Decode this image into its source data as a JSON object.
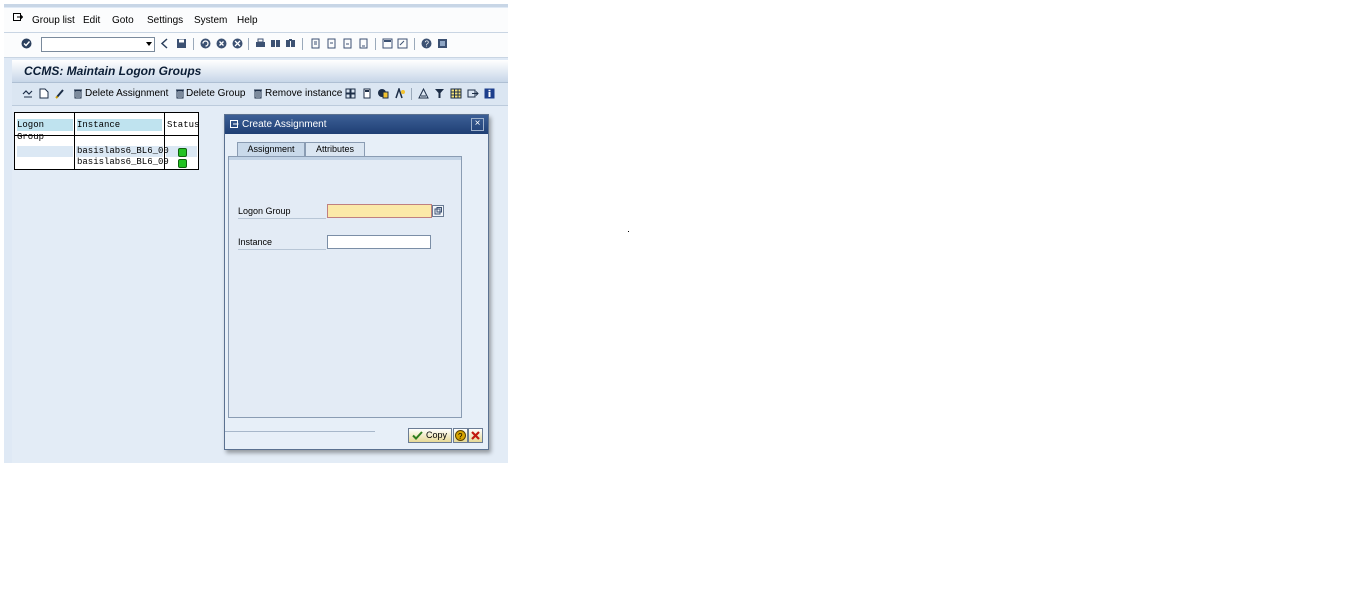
{
  "menu": {
    "items": [
      "Group list",
      "Edit",
      "Goto",
      "Settings",
      "System",
      "Help"
    ]
  },
  "toolbar": {
    "command_field_value": "",
    "icons": [
      "enter-icon",
      "back-icon",
      "save-icon",
      "exit-icon",
      "cancel-icon",
      "print-icon",
      "find-icon",
      "find-next-icon",
      "first-page-icon",
      "prev-page-icon",
      "next-page-icon",
      "last-page-icon",
      "new-session-icon",
      "shortcut-icon",
      "help-icon",
      "customize-layout-icon"
    ]
  },
  "title": "CCMS: Maintain Logon Groups",
  "app_toolbar": {
    "delete_assignment": "Delete Assignment",
    "delete_group": "Delete Group",
    "remove_instance": "Remove instance"
  },
  "table": {
    "headers": [
      "Logon Group",
      "Instance",
      "Status"
    ],
    "rows": [
      {
        "group": "",
        "instance": "basislabs6_BL6_00",
        "status": "green"
      },
      {
        "group": "",
        "instance": "basislabs6_BL6_09",
        "status": "green"
      }
    ]
  },
  "dialog": {
    "title": "Create Assignment",
    "close": "×",
    "tabs": [
      "Assignment",
      "Attributes"
    ],
    "fields": {
      "logon_group_label": "Logon Group",
      "logon_group_value": "",
      "instance_label": "Instance",
      "instance_value": ""
    },
    "copy_label": "Copy"
  },
  "colors": {
    "status_green": "#23c323",
    "title_bar": "#1f3f74",
    "required_field": "#fbe9a8"
  }
}
